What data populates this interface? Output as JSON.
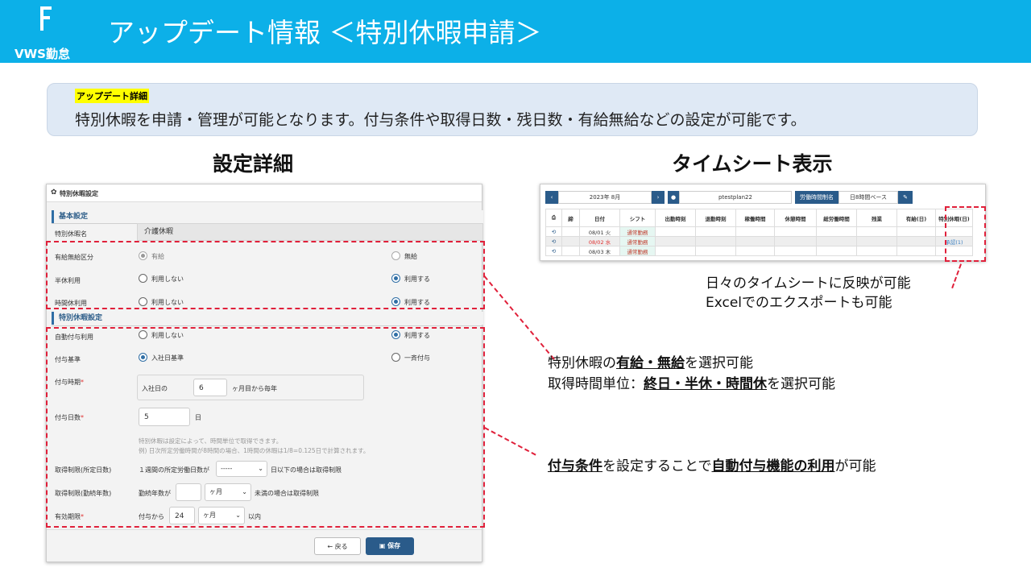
{
  "header": {
    "logo_text": "VWS勤怠",
    "title": "アップデート情報 ＜特別休暇申請＞"
  },
  "update": {
    "label": "アップデート詳細",
    "text": "特別休暇を申請・管理が可能となります。付与条件や取得日数・残日数・有給無給などの設定が可能です。"
  },
  "headings": {
    "settings": "設定詳細",
    "timesheet": "タイムシート表示"
  },
  "panel": {
    "title": "特別休暇設定",
    "basic_section": "基本設定",
    "name_label": "特別休暇名",
    "name_value": "介護休暇",
    "paid_label": "有給無給区分",
    "paid_opt1": "有給",
    "paid_opt2": "無給",
    "half_label": "半休利用",
    "half_opt1": "利用しない",
    "half_opt2": "利用する",
    "hourly_label": "時間休利用",
    "hourly_opt1": "利用しない",
    "hourly_opt2": "利用する",
    "special_section": "特別休暇設定",
    "auto_label": "自動付与利用",
    "auto_opt1": "利用しない",
    "auto_opt2": "利用する",
    "basis_label": "付与基準",
    "basis_opt1": "入社日基準",
    "basis_opt2": "一斉付与",
    "timing_label": "付与時期",
    "timing_prefix": "入社日の",
    "timing_value": "6",
    "timing_suffix": "ヶ月目から毎年",
    "days_label": "付与日数",
    "days_value": "5",
    "days_unit": "日",
    "note1": "特別休暇は設定によって、時間単位で取得できます。",
    "note2": "例) 日次所定労働時間が8時間の場合、1時間の休暇は1/8=0.125日で計算されます。",
    "limit1_label": "取得制限(所定日数)",
    "limit1_prefix": "１週間の所定労働日数が",
    "limit1_select": "-----",
    "limit1_suffix": "日以下の場合は取得制限",
    "limit2_label": "取得制限(勤続年数)",
    "limit2_prefix": "勤続年数が",
    "limit2_value": "",
    "limit2_select": "ヶ月",
    "limit2_suffix": "未満の場合は取得制限",
    "expiry_label": "有効期限",
    "expiry_prefix": "付与から",
    "expiry_value": "24",
    "expiry_select": "ヶ月",
    "expiry_suffix": "以内",
    "required_mark": "*",
    "back_button": "← 戻る",
    "save_button": "保存"
  },
  "timesheet": {
    "month": "2023年 8月",
    "user": "ptestplan22",
    "rule_label": "労働時間制名",
    "rule_value": "日8時間ベース",
    "columns": [
      "",
      "締",
      "日付",
      "シフト",
      "出勤時刻",
      "退勤時刻",
      "稼働時間",
      "休憩時間",
      "総労働時間",
      "残業",
      "有給(日)",
      "特別休暇(日)"
    ],
    "rows": [
      {
        "date": "08/01 火",
        "shift": "通常勤務",
        "special": ""
      },
      {
        "date": "08/02 水",
        "shift": "通常勤務",
        "special": "承認(1)"
      },
      {
        "date": "08/03 木",
        "shift": "通常勤務",
        "special": ""
      }
    ]
  },
  "annotations": {
    "ts1": "日々のタイムシートに反映が可能",
    "ts2": "Excelでのエクスポートも可能",
    "a1_pre": "特別休暇の",
    "a1_b": "有給・無給",
    "a1_post": "を選択可能",
    "a2_pre": "取得時間単位：",
    "a2_b": "終日・半休・時間休",
    "a2_post": "を選択可能",
    "a3_b1": "付与条件",
    "a3_mid": "を設定することで",
    "a3_b2": "自動付与機能の利用",
    "a3_post": "が可能"
  }
}
